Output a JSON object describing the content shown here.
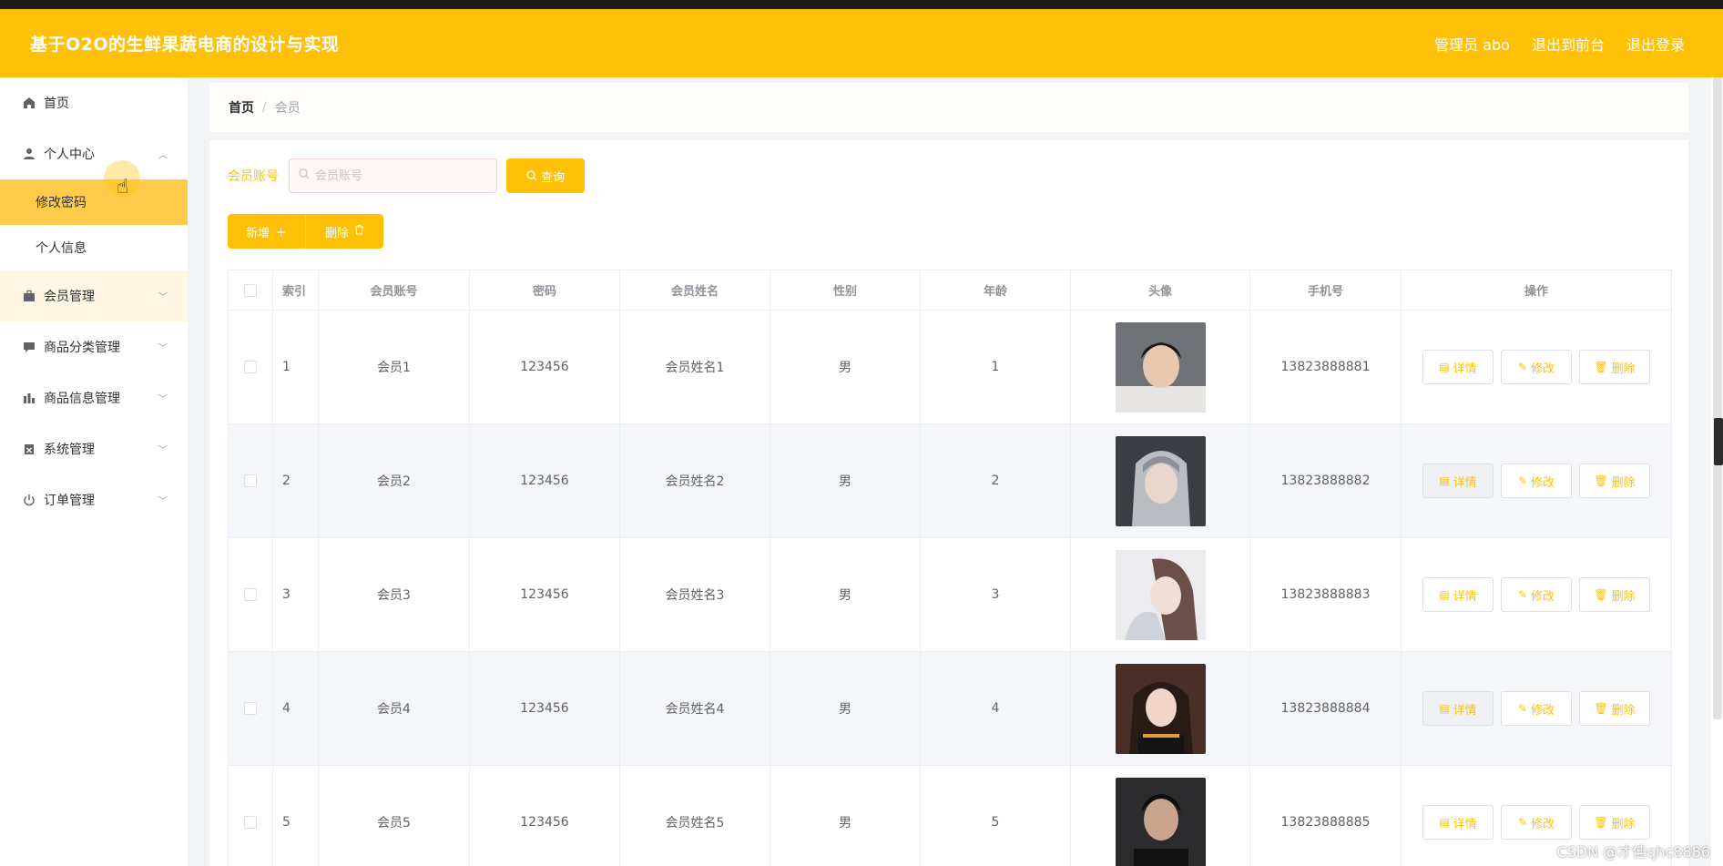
{
  "header": {
    "title": "基于O2O的生鲜果蔬电商的设计与实现",
    "admin_label": "管理员 abo",
    "exit_front": "退出到前台",
    "logout": "退出登录"
  },
  "sidebar": {
    "home": "首页",
    "personal_center": "个人中心",
    "change_password": "修改密码",
    "personal_info": "个人信息",
    "member_mgmt": "会员管理",
    "category_mgmt": "商品分类管理",
    "goods_mgmt": "商品信息管理",
    "system_mgmt": "系统管理",
    "order_mgmt": "订单管理"
  },
  "breadcrumb": {
    "home": "首页",
    "separator": "/",
    "current": "会员"
  },
  "search": {
    "label": "会员账号",
    "placeholder": "会员账号",
    "button": "查询"
  },
  "actions": {
    "add": "新增",
    "delete": "删除"
  },
  "table": {
    "headers": {
      "index": "索引",
      "account": "会员账号",
      "password": "密码",
      "name": "会员姓名",
      "gender": "性别",
      "age": "年龄",
      "avatar": "头像",
      "phone": "手机号",
      "operation": "操作"
    },
    "rows": [
      {
        "index": "1",
        "account": "会员1",
        "password": "123456",
        "name": "会员姓名1",
        "gender": "男",
        "age": "1",
        "phone": "13823888881"
      },
      {
        "index": "2",
        "account": "会员2",
        "password": "123456",
        "name": "会员姓名2",
        "gender": "男",
        "age": "2",
        "phone": "13823888882"
      },
      {
        "index": "3",
        "account": "会员3",
        "password": "123456",
        "name": "会员姓名3",
        "gender": "男",
        "age": "3",
        "phone": "13823888883"
      },
      {
        "index": "4",
        "account": "会员4",
        "password": "123456",
        "name": "会员姓名4",
        "gender": "男",
        "age": "4",
        "phone": "13823888884"
      },
      {
        "index": "5",
        "account": "会员5",
        "password": "123456",
        "name": "会员姓名5",
        "gender": "男",
        "age": "5",
        "phone": "13823888885"
      }
    ],
    "row_buttons": {
      "detail": "详情",
      "edit": "修改",
      "delete": "删除"
    }
  },
  "watermark": "CSDN @才佳qhc8886",
  "colors": {
    "accent": "#ffc107",
    "active_submenu": "#fecc4a"
  }
}
